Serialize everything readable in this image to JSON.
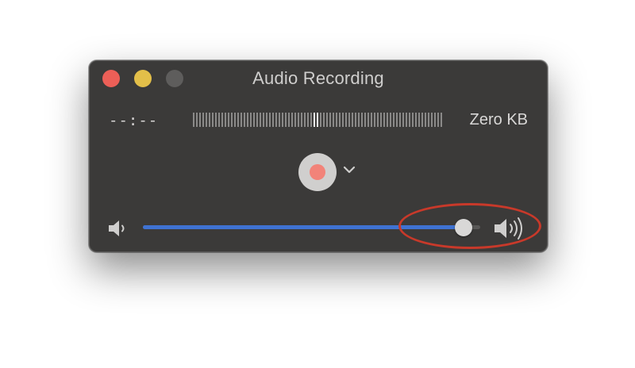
{
  "window": {
    "title": "Audio Recording",
    "traffic_lights": [
      {
        "name": "close",
        "color": "#ec5f57"
      },
      {
        "name": "minimize",
        "color": "#e3bf49"
      },
      {
        "name": "zoom",
        "color": "#5e5d5c"
      }
    ]
  },
  "recording": {
    "time": "--:--",
    "file_size": "Zero KB",
    "record_color": "#f28379",
    "level_meter_icon": "audio-level-meter-icon",
    "record_icon": "record-dot-icon",
    "options_icon": "chevron-down-icon"
  },
  "volume": {
    "level": 0.95,
    "fill_color": "#3f72d2",
    "low_icon": "speaker-low-icon",
    "high_icon": "speaker-high-icon"
  },
  "annotation": {
    "color": "#c8392a"
  }
}
